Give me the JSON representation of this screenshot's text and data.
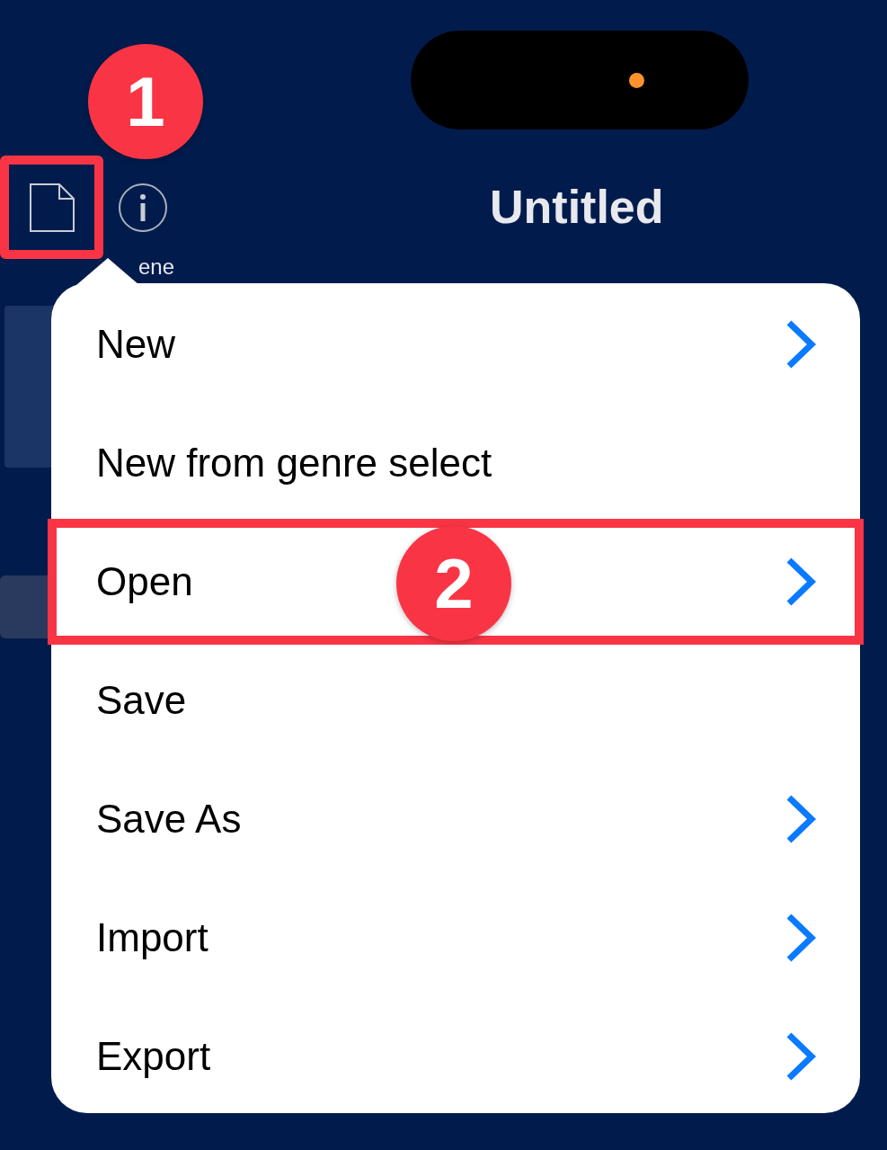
{
  "header": {
    "title": "Untitled",
    "scene_label": "ene"
  },
  "menu": {
    "items": [
      {
        "label": "New",
        "submenu": true,
        "highlighted": false
      },
      {
        "label": "New from genre select",
        "submenu": false,
        "highlighted": false
      },
      {
        "label": "Open",
        "submenu": true,
        "highlighted": true
      },
      {
        "label": "Save",
        "submenu": false,
        "highlighted": false
      },
      {
        "label": "Save As",
        "submenu": true,
        "highlighted": false
      },
      {
        "label": "Import",
        "submenu": true,
        "highlighted": false
      },
      {
        "label": "Export",
        "submenu": true,
        "highlighted": false
      }
    ]
  },
  "file_button": {
    "framed": true
  },
  "annotations": [
    {
      "number": "1"
    },
    {
      "number": "2"
    }
  ]
}
